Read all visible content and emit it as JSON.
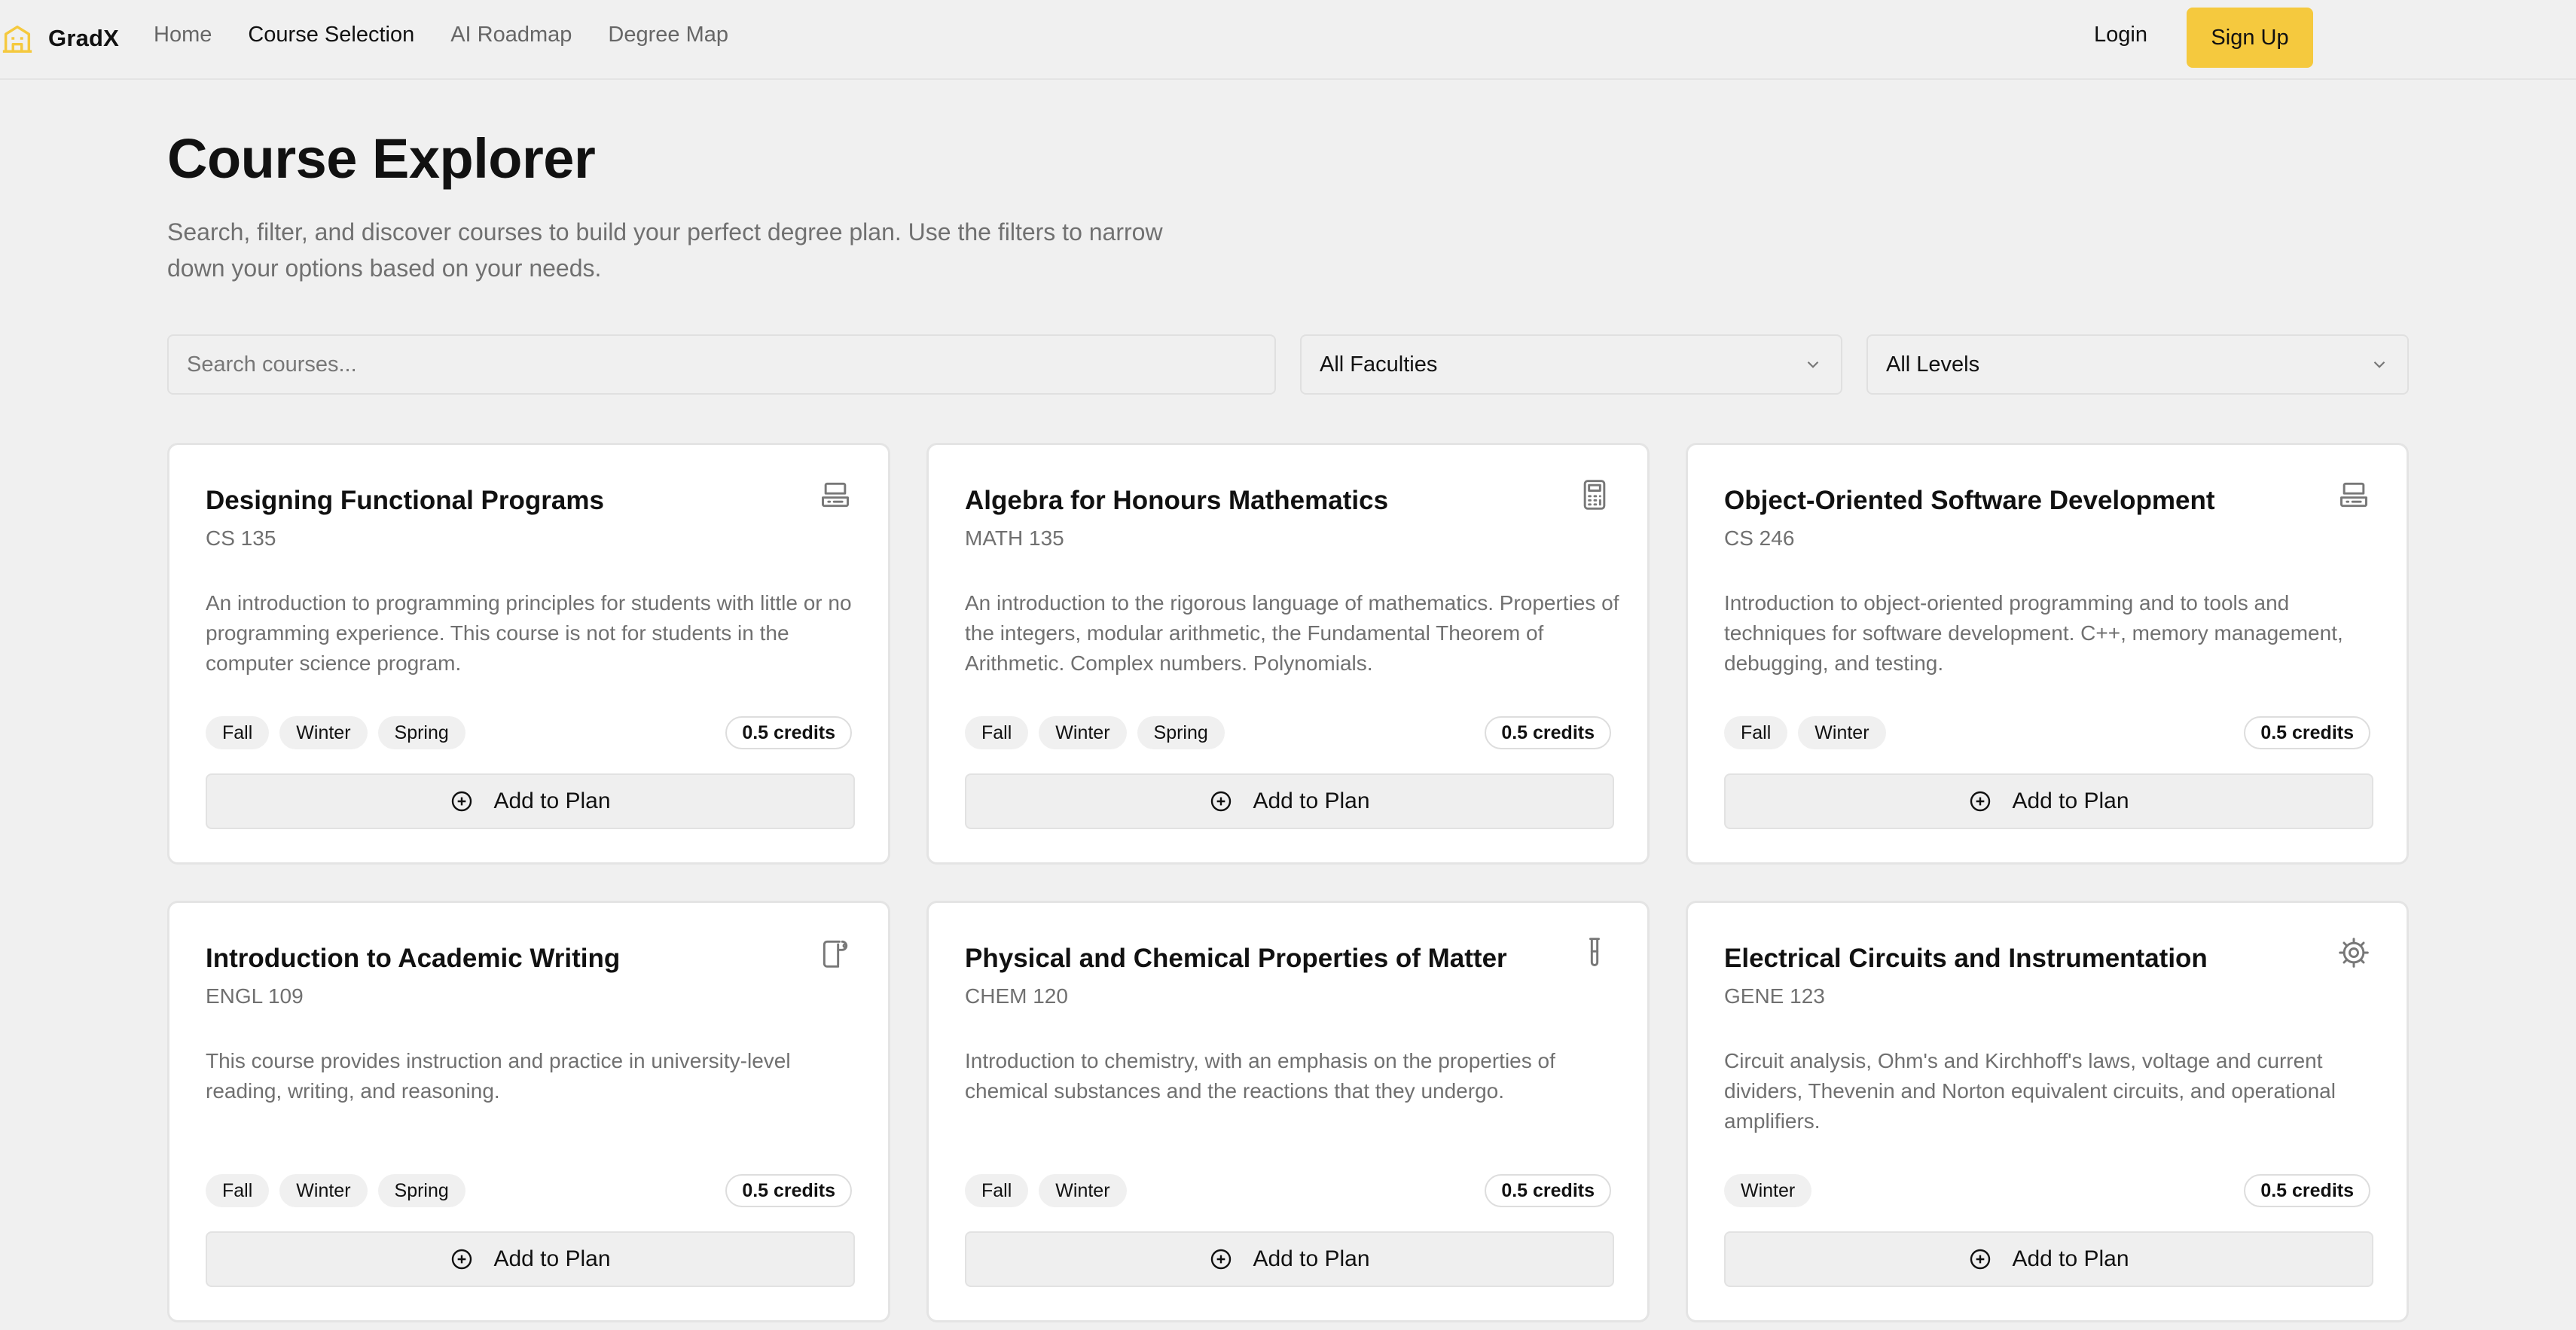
{
  "nav": {
    "brand": "GradX",
    "links": [
      "Home",
      "Course Selection",
      "AI Roadmap",
      "Degree Map"
    ],
    "active_link": "Course Selection",
    "login": "Login",
    "signup": "Sign Up",
    "accent_color": "#f5c93e"
  },
  "header": {
    "title": "Course Explorer",
    "description": "Search, filter, and discover courses to build your perfect degree plan. Use the filters to narrow down your options based on your needs."
  },
  "filters": {
    "search_placeholder": "Search courses...",
    "faculty_selected": "All Faculties",
    "level_selected": "All Levels"
  },
  "add_label": "Add to Plan",
  "courses": [
    {
      "title": "Designing Functional Programs",
      "code": "CS 135",
      "icon": "computer-icon",
      "description": "An introduction to programming principles for students with little or no programming experience. This course is not for students in the computer science program.",
      "terms": [
        "Fall",
        "Winter",
        "Spring"
      ],
      "credits": "0.5 credits"
    },
    {
      "title": "Algebra for Honours Mathematics",
      "code": "MATH 135",
      "icon": "calculator-icon",
      "description": "An introduction to the rigorous language of mathematics. Properties of the integers, modular arithmetic, the Fundamental Theorem of Arithmetic. Complex numbers. Polynomials.",
      "terms": [
        "Fall",
        "Winter",
        "Spring"
      ],
      "credits": "0.5 credits"
    },
    {
      "title": "Object-Oriented Software Development",
      "code": "CS 246",
      "icon": "computer-icon",
      "description": "Introduction to object-oriented programming and to tools and techniques for software development. C++, memory management, debugging, and testing.",
      "terms": [
        "Fall",
        "Winter"
      ],
      "credits": "0.5 credits"
    },
    {
      "title": "Introduction to Academic Writing",
      "code": "ENGL 109",
      "icon": "scroll-quill-icon",
      "description": "This course provides instruction and practice in university-level reading, writing, and reasoning.",
      "terms": [
        "Fall",
        "Winter",
        "Spring"
      ],
      "credits": "0.5 credits"
    },
    {
      "title": "Physical and Chemical Properties of Matter",
      "code": "CHEM 120",
      "icon": "test-tube-icon",
      "description": "Introduction to chemistry, with an emphasis on the properties of chemical substances and the reactions that they undergo.",
      "terms": [
        "Fall",
        "Winter"
      ],
      "credits": "0.5 credits"
    },
    {
      "title": "Electrical Circuits and Instrumentation",
      "code": "GENE 123",
      "icon": "gear-icon",
      "description": "Circuit analysis, Ohm's and Kirchhoff's laws, voltage and current dividers, Thevenin and Norton equivalent circuits, and operational amplifiers.",
      "terms": [
        "Winter"
      ],
      "credits": "0.5 credits"
    }
  ]
}
